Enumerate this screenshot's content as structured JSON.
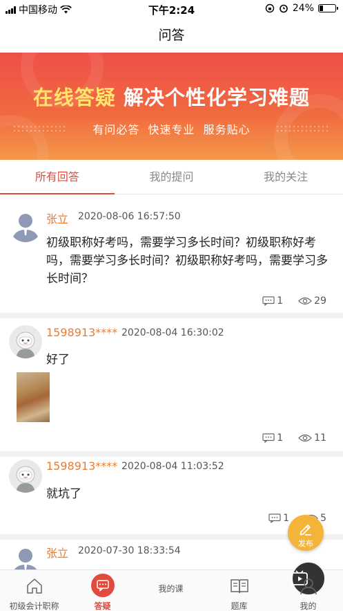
{
  "status_bar": {
    "carrier": "中国移动",
    "time": "下午2:24",
    "battery": "24%"
  },
  "nav": {
    "title": "问答"
  },
  "banner": {
    "title_highlight": "在线答疑",
    "title_rest": "解决个性化学习难题",
    "subtitle": "有问必答  快速专业  服务贴心"
  },
  "tabs": [
    {
      "label": "所有回答",
      "active": true
    },
    {
      "label": "我的提问",
      "active": false
    },
    {
      "label": "我的关注",
      "active": false
    }
  ],
  "posts": [
    {
      "user": "张立",
      "time": "2020-08-06 16:57:50",
      "content": "初级职称好考吗，需要学习多长时间？初级职称好考吗，需要学习多长时间？初级职称好考吗，需要学习多长时间？",
      "comments": "1",
      "views": "29"
    },
    {
      "user": "1598913****",
      "time": "2020-08-04 16:30:02",
      "content": "好了",
      "comments": "1",
      "views": "11"
    },
    {
      "user": "1598913****",
      "time": "2020-08-04 11:03:52",
      "content": "就坑了",
      "comments": "1",
      "views": "5"
    },
    {
      "user": "张立",
      "time": "2020-07-30 18:33:54"
    }
  ],
  "fab": {
    "label": "发布"
  },
  "tabbar": [
    {
      "label": "初级会计职称",
      "icon": "home-icon"
    },
    {
      "label": "答疑",
      "icon": "chat-icon",
      "active": true
    },
    {
      "label": "我的课",
      "icon": "play-icon"
    },
    {
      "label": "题库",
      "icon": "book-icon"
    },
    {
      "label": "我的",
      "icon": "user-icon"
    }
  ],
  "colors": {
    "accent": "#e24a3d",
    "username": "#ec7b2e",
    "fab": "#f4b43a"
  }
}
